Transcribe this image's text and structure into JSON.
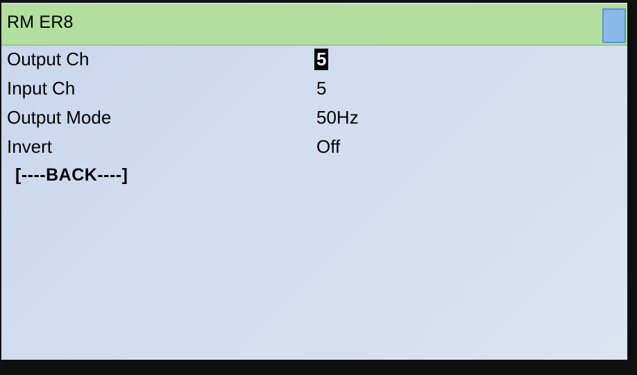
{
  "header": {
    "title": "RM ER8"
  },
  "menu": {
    "items": [
      {
        "label": "Output Ch",
        "value": "5",
        "selected": true
      },
      {
        "label": "Input Ch",
        "value": "5",
        "selected": false
      },
      {
        "label": "Output Mode",
        "value": "50Hz",
        "selected": false
      },
      {
        "label": "Invert",
        "value": "Off",
        "selected": false
      }
    ],
    "back_label": "[----BACK----]"
  },
  "colors": {
    "titlebar": "#b2df9e",
    "screen_background": "#d3ddf0",
    "selection_background": "#000000",
    "scrollbar": "#8ab8e8"
  }
}
